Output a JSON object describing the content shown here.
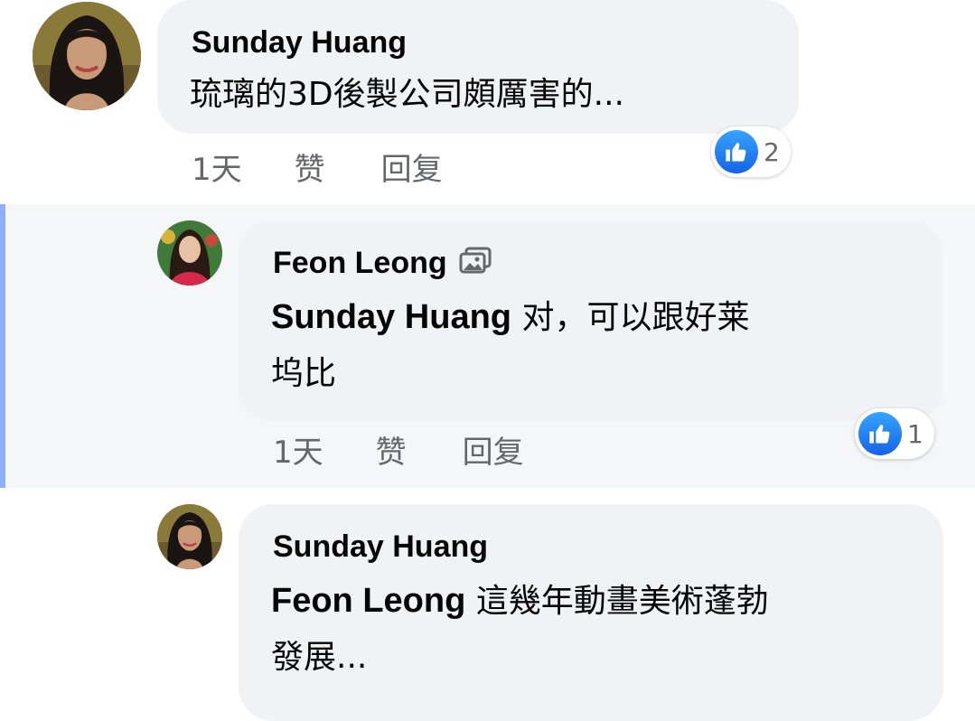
{
  "colors": {
    "bubble": "#f0f2f5",
    "meta_text": "#65676b",
    "highlight_bar": "#8fb0f5",
    "like_blue": "#1877f2"
  },
  "comments": [
    {
      "author": "Sunday Huang",
      "text": "琉璃的3D後製公司頗厲害的...",
      "time": "1天",
      "like_label": "赞",
      "reply_label": "回复",
      "reaction_count": "2",
      "reaction_icon": "thumbs-up-icon"
    },
    {
      "author": "Feon Leong",
      "author_icon": "photo-icon",
      "mention": "Sunday Huang",
      "text_line1": " 对，可以跟好莱",
      "text_line2": "坞比",
      "time": "1天",
      "like_label": "赞",
      "reply_label": "回复",
      "reaction_count": "1",
      "reaction_icon": "thumbs-up-icon"
    },
    {
      "author": "Sunday Huang",
      "mention": "Feon Leong",
      "text_line1": " 這幾年動畫美術蓬勃",
      "text_line2": "發展..."
    }
  ]
}
